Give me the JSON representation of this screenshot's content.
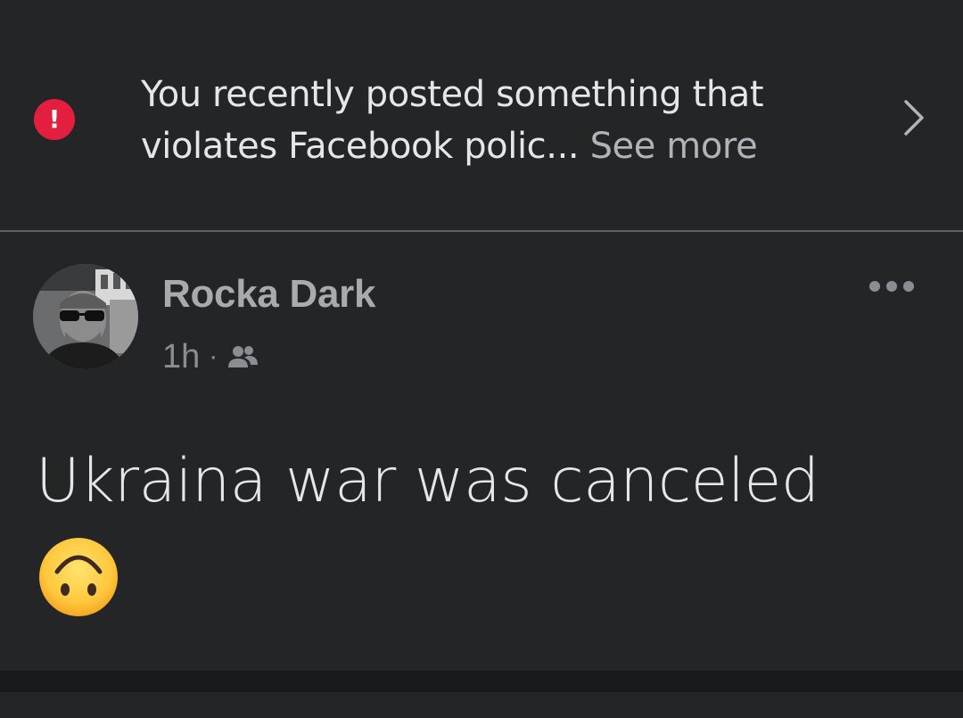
{
  "warning": {
    "icon": "alert-icon",
    "icon_glyph": "!",
    "line1": "You recently posted something that",
    "line2": "violates Facebook polic...",
    "see_more": "See more",
    "chevron_icon": "chevron-right-icon",
    "accent_color": "#e41e3f"
  },
  "post": {
    "author": "Rocka Dark",
    "time": "1h",
    "separator": "·",
    "audience_icon": "friends-icon",
    "more_icon": "more-horizontal-icon",
    "text": "Ukraina war was canceled",
    "emoji": "upside-down-face-emoji"
  },
  "colors": {
    "background": "#242526",
    "feed_gap": "#18191a",
    "primary_text": "#e4e6eb",
    "secondary_text": "#b0b3b8"
  }
}
